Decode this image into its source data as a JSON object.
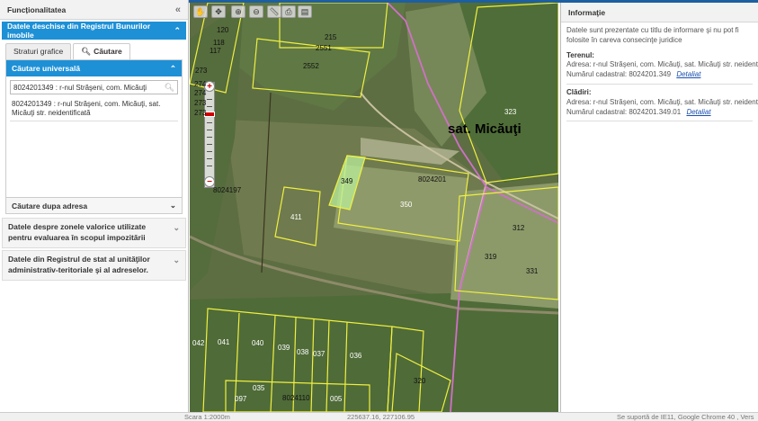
{
  "left_panel": {
    "title": "Funcționalitatea",
    "collapse_icon": "double-chevron-left-icon",
    "registry_header": "Datele deschise din Registrul Bunurilor imobile",
    "tabs": [
      "Straturi grafice",
      "Căutare"
    ],
    "search_section": {
      "header": "Căutare universală",
      "input_value": "8024201349 : r-nul Străşeni, com. Micăuţi",
      "result": "8024201349 : r-nul Străşeni, com. Micăuţi, sat. Micăuţi str. neidentificată",
      "footer": "Căutare dupa adresa"
    },
    "sections": [
      "Datele despre zonele valorice utilizate pentru evaluarea în scopul impozitării",
      "Datele din Registrul de stat al unităţilor administrativ-teritoriale şi al adreselor."
    ]
  },
  "map": {
    "village_label": "sat. Micăuţi",
    "parcels": [
      "120",
      "118",
      "117",
      "215",
      "2551",
      "2552",
      "273",
      "274",
      "274",
      "273",
      "273",
      "323",
      "349",
      "8024201",
      "350",
      "411",
      "312",
      "319",
      "331",
      "042",
      "041",
      "040",
      "039",
      "038",
      "037",
      "036",
      "035",
      "097",
      "8024110",
      "005",
      "320"
    ],
    "cadastral_label": "8024197",
    "tool_icons": [
      "pan-icon",
      "move-icon",
      "zoom-in-box-icon",
      "zoom-out-box-icon",
      "measure-icon",
      "print-icon",
      "layers-icon"
    ]
  },
  "right_panel": {
    "title": "Informaţie",
    "disclaimer": "Datele sunt prezentate cu titlu de informare şi nu pot fi folosite în careva consecinţe juridice",
    "land": {
      "label": "Terenul:",
      "address": "Adresa: r-nul Străşeni, com. Micăuţi, sat. Micăuţi str. neidentificată",
      "cadastral": "Numărul cadastral: 8024201.349",
      "link": "Detaliat"
    },
    "buildings": {
      "label": "Clădiri:",
      "address": "Adresa: r-nul Străşeni, com. Micăuţi, sat. Micăuţi str. neidentificată",
      "cadastral": "Numărul cadastral: 8024201.349.01",
      "link": "Detaliat"
    }
  },
  "status": {
    "scale": "Scara 1:2000m",
    "coords": "225637.16, 227106.95",
    "support": "Se suportă de IE11, Google Chrome 40 , Vers"
  }
}
